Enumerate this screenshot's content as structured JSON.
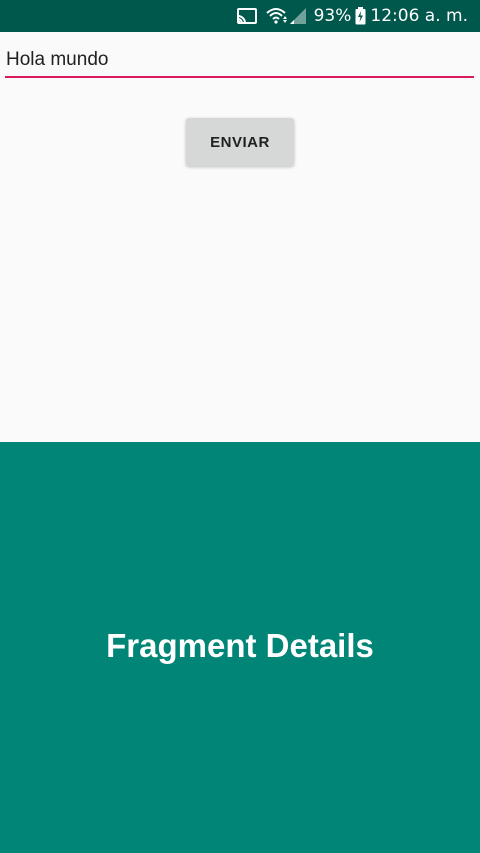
{
  "status_bar": {
    "battery_percent": "93%",
    "time": "12:06 a. m.",
    "icons": [
      "cast-icon",
      "wifi-icon",
      "signal-icon",
      "battery-icon"
    ],
    "background_color": "#00574b"
  },
  "form": {
    "input_value": "Hola mundo",
    "underline_color": "#d81b60",
    "send_button_label": "ENVIAR"
  },
  "fragment": {
    "title": "Fragment Details",
    "background_color": "#008577"
  }
}
